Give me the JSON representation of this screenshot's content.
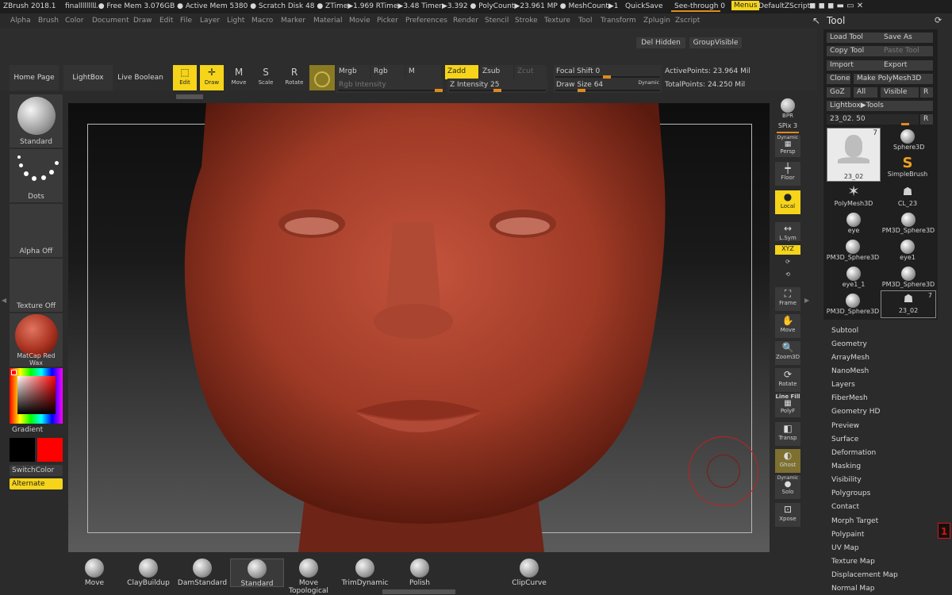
{
  "titlebar": {
    "app": "ZBrush 2018.1",
    "file": "finalllllllll",
    "stats": "..● Free Mem 3.076GB ● Active Mem 5380 ● Scratch Disk 48 ● ZTime▶1.969 RTime▶3.48 Timer▶3.392 ● PolyCount▶23.961 MP ● MeshCount▶1",
    "quicksave": "QuickSave",
    "see_through": "See-through 0",
    "menus": "Menus",
    "default_zscript": "DefaultZScript"
  },
  "menu": [
    "Alpha",
    "Brush",
    "Color",
    "Document",
    "Draw",
    "Edit",
    "File",
    "Layer",
    "Light",
    "Macro",
    "Marker",
    "Material",
    "Movie",
    "Picker",
    "Preferences",
    "Render",
    "Stencil",
    "Stroke",
    "Texture",
    "Tool",
    "Transform",
    "Zplugin",
    "Zscript"
  ],
  "shelf": {
    "del_hidden": "Del Hidden",
    "group_visible": "GroupVisible",
    "home_page": "Home Page",
    "lightbox": "LightBox",
    "live_boolean": "Live Boolean",
    "edit": "Edit",
    "draw": "Draw",
    "move": "Move",
    "scale": "Scale",
    "rotate": "Rotate",
    "mrgb": "Mrgb",
    "rgb": "Rgb",
    "m": "M",
    "rgb_intensity": "Rgb Intensity",
    "zadd": "Zadd",
    "zsub": "Zsub",
    "zcut": "Zcut",
    "z_intensity": "Z Intensity 25",
    "focal_shift": "Focal Shift 0",
    "draw_size": "Draw Size 64",
    "dynamic": "Dynamic",
    "active_points": "ActivePoints: 23.964 Mil",
    "total_points": "TotalPoints: 24.250 Mil"
  },
  "lefttray": {
    "standard": "Standard",
    "dots": "Dots",
    "alpha_off": "Alpha Off",
    "texture_off": "Texture Off",
    "matcap": "MatCap Red Wax",
    "gradient": "Gradient",
    "switchcolor": "SwitchColor",
    "alternate": "Alternate",
    "main_color": "#000000",
    "secondary_color": "#ff0000"
  },
  "rightstrip": {
    "bpr": "BPR",
    "spix": "SPix 3",
    "dynamic": "Dynamic",
    "persp": "Persp",
    "floor": "Floor",
    "local": "Local",
    "lsym": "L.Sym",
    "xyz": "XYZ",
    "frame": "Frame",
    "move": "Move",
    "zoom3d": "Zoom3D",
    "rotate": "Rotate",
    "line_fill": "Line Fill",
    "polyf": "PolyF",
    "transp": "Transp",
    "ghost": "Ghost",
    "dynamic2": "Dynamic",
    "solo": "Solo",
    "xpose": "Xpose"
  },
  "tool": {
    "title": "Tool",
    "load_tool": "Load Tool",
    "save_as": "Save As",
    "copy_tool": "Copy Tool",
    "paste_tool": "Paste Tool",
    "import": "Import",
    "export": "Export",
    "clone": "Clone",
    "make_polymesh": "Make PolyMesh3D",
    "goz": "GoZ",
    "all": "All",
    "visible": "Visible",
    "r": "R",
    "lightbox_tools": "Lightbox▶Tools",
    "current": "23_02. 50",
    "r2": "R",
    "thumbs": [
      "Sphere3D",
      "SimpleBrush",
      "PolyMesh3D",
      "CL_23",
      "eye",
      "PM3D_Sphere3D",
      "PM3D_Sphere3D",
      "eye1",
      "eye1_1",
      "PM3D_Sphere3D",
      "PM3D_Sphere3D",
      "23_02"
    ],
    "main_thumb": "23_02",
    "main_count": "7",
    "small_count": "7",
    "subpalettes": [
      "Subtool",
      "Geometry",
      "ArrayMesh",
      "NanoMesh",
      "Layers",
      "FiberMesh",
      "Geometry HD",
      "Preview",
      "Surface",
      "Deformation",
      "Masking",
      "Visibility",
      "Polygroups",
      "Contact",
      "Morph Target",
      "Polypaint",
      "UV Map",
      "Texture Map",
      "Displacement Map",
      "Normal Map"
    ]
  },
  "bottom_brushes": [
    "Move",
    "ClayBuildup",
    "DamStandard",
    "Standard",
    "Move Topological",
    "TrimDynamic",
    "Polish",
    "ClipCurve"
  ],
  "badge": "1"
}
